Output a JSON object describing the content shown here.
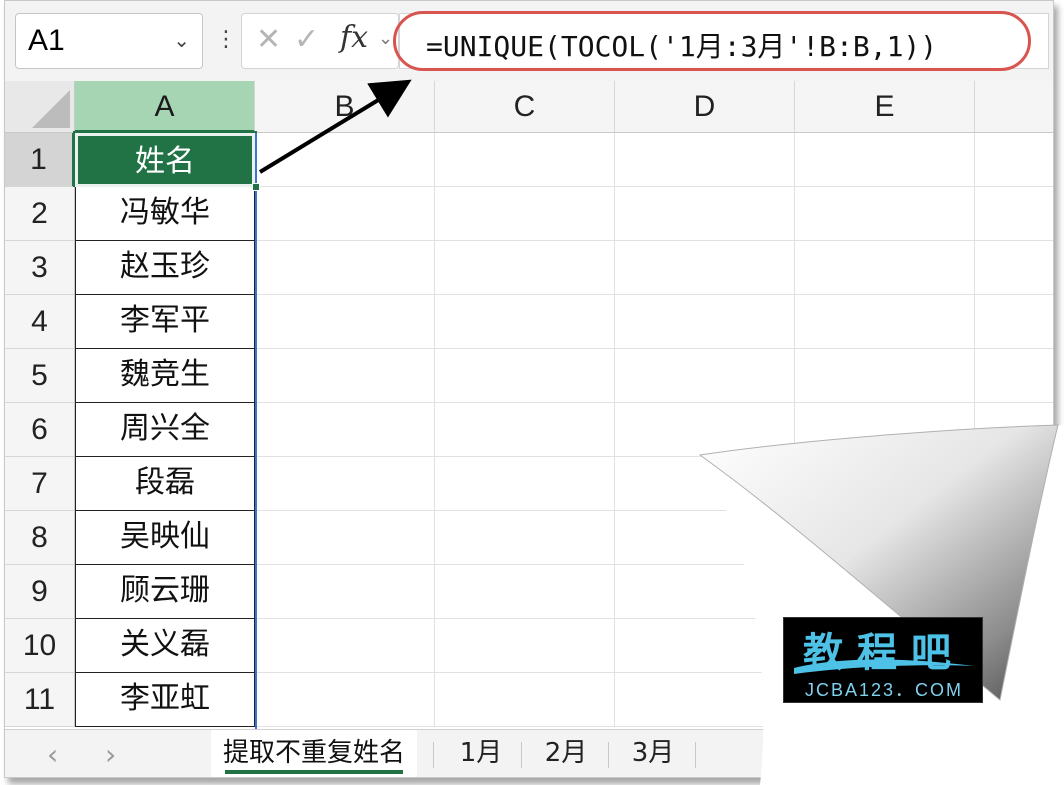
{
  "name_box": {
    "value": "A1"
  },
  "formula_bar": {
    "cancel_icon": "close-icon",
    "enter_icon": "check-icon",
    "fx_label": "fx",
    "formula": "=UNIQUE(TOCOL('1月:3月'!B:B,1))"
  },
  "columns": [
    "A",
    "B",
    "C",
    "D",
    "E"
  ],
  "rows": [
    "1",
    "2",
    "3",
    "4",
    "5",
    "6",
    "7",
    "8",
    "9",
    "10",
    "11"
  ],
  "column_a": [
    "姓名",
    "冯敏华",
    "赵玉珍",
    "李军平",
    "魏竞生",
    "周兴全",
    "段磊",
    "吴映仙",
    "顾云珊",
    "关义磊",
    "李亚虹"
  ],
  "sheet_tabs": {
    "active": "提取不重复姓名",
    "others": [
      "1月",
      "2月",
      "3月"
    ]
  },
  "watermark": {
    "title": "教程吧",
    "subtitle": "JCBA123．COM"
  },
  "colors": {
    "accent": "#217346",
    "highlight_ring": "#d9534f",
    "spill_border": "#3b74d6"
  }
}
